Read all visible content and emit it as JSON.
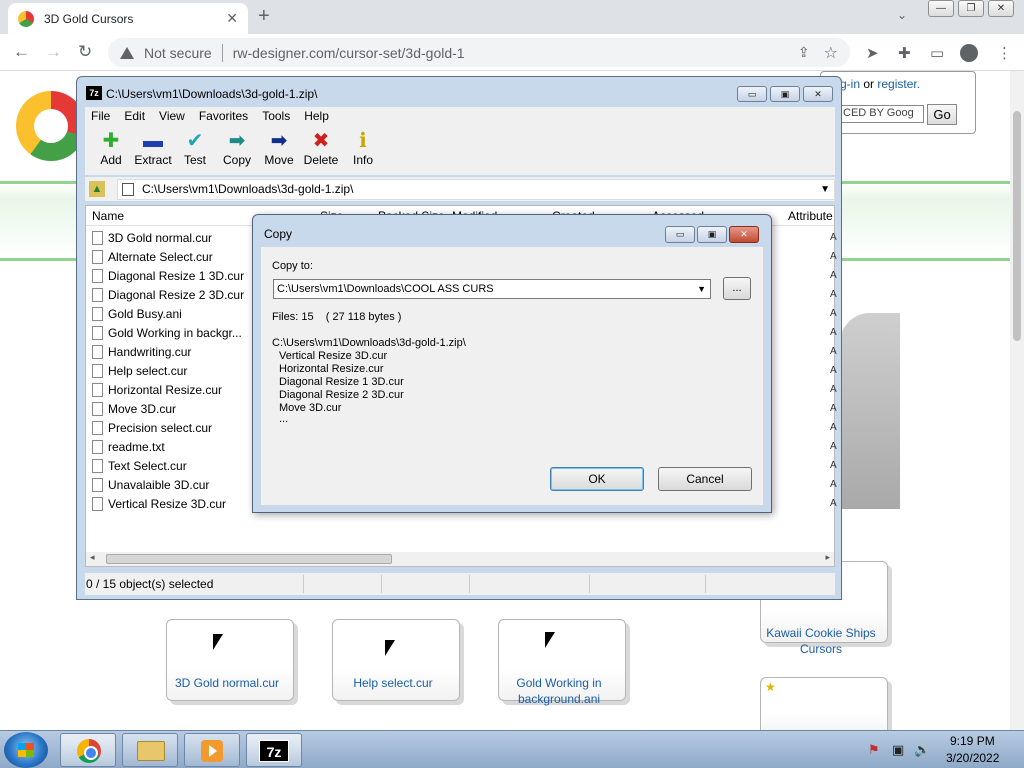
{
  "browser": {
    "tab_title": "3D Gold Cursors",
    "tab_close": "✕",
    "new_tab": "+",
    "tab_search": "⌄",
    "min": "—",
    "max": "❐",
    "close": "✕",
    "back": "←",
    "forward": "→",
    "reload": "↻",
    "not_secure": "Not secure",
    "url": "rw-designer.com/cursor-set/3d-gold-1",
    "share": "⇪",
    "star": "☆",
    "send": "➤",
    "extensions": "✚",
    "sidebar": "▭",
    "menu": "⋮"
  },
  "webpage": {
    "login_suffix": "g-in",
    "or": " or ",
    "register": "register.",
    "search_text": "CED BY Goog",
    "go": "Go",
    "cards": [
      {
        "label": "3D Gold normal.cur"
      },
      {
        "label": "Help select.cur"
      },
      {
        "label": "Gold Working in background.ani"
      },
      {
        "label": "Kawaii Cookie Ships Cursors"
      }
    ],
    "star_badge": "★"
  },
  "zip": {
    "title": "C:\\Users\\vm1\\Downloads\\3d-gold-1.zip\\",
    "app_icon": "7z",
    "min": "▭",
    "max": "▣",
    "close": "✕",
    "menu": [
      "File",
      "Edit",
      "View",
      "Favorites",
      "Tools",
      "Help"
    ],
    "tools": [
      {
        "label": "Add",
        "icon": "✚",
        "color": "#2fae2f"
      },
      {
        "label": "Extract",
        "icon": "▬",
        "color": "#1e3fae"
      },
      {
        "label": "Test",
        "icon": "✔",
        "color": "#1fa7b5"
      },
      {
        "label": "Copy",
        "icon": "➡",
        "color": "#1e8a8a"
      },
      {
        "label": "Move",
        "icon": "➡",
        "color": "#0f2f8a"
      },
      {
        "label": "Delete",
        "icon": "✖",
        "color": "#d01f1f"
      },
      {
        "label": "Info",
        "icon": "ℹ",
        "color": "#c9a400"
      }
    ],
    "address": "C:\\Users\\vm1\\Downloads\\3d-gold-1.zip\\",
    "address_dropdown": "▼",
    "columns": [
      "Name",
      "Size",
      "Packed Size",
      "Modified",
      "Created",
      "Accessed",
      "Attribute"
    ],
    "files": [
      "3D Gold normal.cur",
      "Alternate Select.cur",
      "Diagonal Resize 1 3D.cur",
      "Diagonal Resize 2 3D.cur",
      "Gold Busy.ani",
      "Gold Working in backgr...",
      "Handwriting.cur",
      "Help select.cur",
      "Horizontal Resize.cur",
      "Move 3D.cur",
      "Precision select.cur",
      "readme.txt",
      "Text Select.cur",
      "Unavalaible 3D.cur",
      "Vertical Resize 3D.cur"
    ],
    "row_mark": "A",
    "scroll_left": "◂",
    "scroll_right": "▸",
    "status": "0 / 15 object(s) selected"
  },
  "dialog": {
    "title": "Copy",
    "min": "▭",
    "max": "▣",
    "close": "✕",
    "copy_to_label": "Copy to:",
    "path_value": "C:\\Users\\vm1\\Downloads\\COOL ASS CURS",
    "path_dropdown": "▼",
    "browse": "...",
    "files_count": "Files: 15    ( 27 118 bytes )",
    "source_path": "C:\\Users\\vm1\\Downloads\\3d-gold-1.zip\\",
    "source_files": [
      "Vertical Resize 3D.cur",
      "Horizontal Resize.cur",
      "Diagonal Resize 1 3D.cur",
      "Diagonal Resize 2 3D.cur",
      "Move 3D.cur",
      "..."
    ],
    "ok": "OK",
    "cancel": "Cancel"
  },
  "taskbar": {
    "sevenzip": "7z",
    "tray": [
      "⚑",
      "▣",
      "🔊"
    ],
    "time": "9:19 PM",
    "date": "3/20/2022"
  }
}
